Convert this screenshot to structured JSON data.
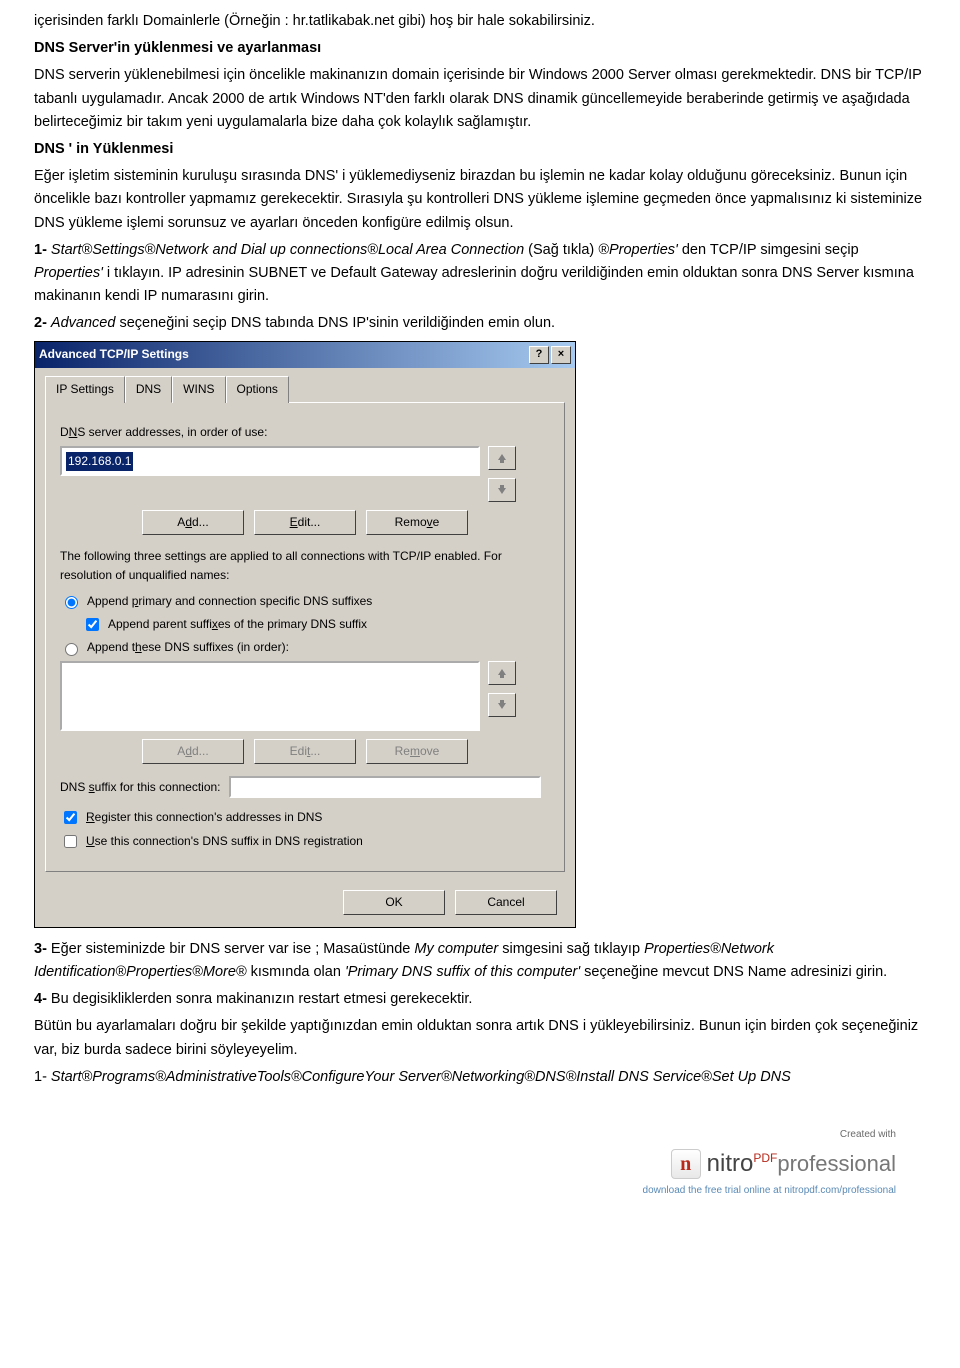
{
  "body": {
    "intro_line": "içerisinden farklı Domainlerle (Örneğin : hr.tatlikabak.net gibi) hoş bir hale sokabilirsiniz.",
    "heading1": "DNS Server'in yüklenmesi ve ayarlanması",
    "para1": "DNS serverin yüklenebilmesi için öncelikle makinanızın domain içerisinde bir Windows 2000 Server olması gerekmektedir. DNS bir TCP/IP tabanlı uygulamadır. Ancak 2000 de artık Windows NT'den farklı olarak DNS dinamik güncellemeyide beraberinde getirmiş ve aşağıdada belirteceğimiz bir takım yeni uygulamalarla bize daha çok kolaylık sağlamıştır.",
    "heading2": "DNS ' in Yüklenmesi",
    "para2a": "Eğer işletim sisteminin kuruluşu sırasında DNS' i yüklemediyseniz birazdan bu işlemin ne kadar kolay olduğunu göreceksiniz. Bunun için öncelikle bazı kontroller yapmamız gerekecektir. Sırasıyla şu kontrolleri DNS yükleme işlemine geçmeden önce yapmalısınız ki sisteminize DNS yükleme işlemi sorunsuz ve ayarları önceden konfigüre edilmiş olsun.",
    "step1_prefix": "1- ",
    "step1_italic": "Start®Settings®Network and Dial up connections®Local Area Connection",
    "step1_mid": "(Sağ tıkla) ",
    "step1_italic2": "®Properties' ",
    "step1_tail": "den TCP/IP simgesini seçip ",
    "step1_italic3": "Properties'",
    "step1_tail2": "i tıklayın. IP adresinin SUBNET ve Default Gateway adreslerinin doğru verildiğinden emin olduktan sonra DNS Server kısmına makinanın kendi IP numarasını girin.",
    "step2_prefix": "2- ",
    "step2_italic": "Advanced ",
    "step2_tail": "seçeneğini seçip DNS tabında DNS IP'sinin verildiğinden emin olun.",
    "step3_prefix": "3- ",
    "step3_a": "Eğer sisteminizde bir DNS server var ise ; Masaüstünde ",
    "step3_italic1": "My computer",
    "step3_b": " simgesini sağ tıklayıp ",
    "step3_italic2": "Properties®Network Identification®Properties®More®",
    "step3_c": " kısmında olan ",
    "step3_italic3": "'Primary DNS suffix of this computer'",
    "step3_d": " seçeneğine mevcut DNS Name adresinizi girin.",
    "step4_prefix": "4- ",
    "step4": "Bu degisikliklerden sonra makinanızın restart etmesi gerekecektir.",
    "closing1": "Bütün bu ayarlamaları doğru bir şekilde yaptığınızdan emin olduktan sonra artık DNS i yükleyebilirsiniz. Bunun için birden çok seçeneğiniz var, biz burda sadece birini söyleyeyelim.",
    "closing2_prefix": "1- ",
    "closing2_italic": "Start®Programs®AdministrativeTools®ConfigureYour Server®Networking®DNS®Install DNS Service®Set Up DNS"
  },
  "dialog": {
    "title": "Advanced TCP/IP Settings",
    "help": "?",
    "close": "×",
    "tabs": {
      "ip": "IP Settings",
      "dns": "DNS",
      "wins": "WINS",
      "options": "Options"
    },
    "label_servers_pre": "D",
    "label_servers_ul": "N",
    "label_servers_post": "S server addresses, in order of use:",
    "server_ip": "192.168.0.1",
    "btn_add_pre": "A",
    "btn_add_ul": "d",
    "btn_add_post": "d...",
    "btn_edit_pre": "",
    "btn_edit_ul": "E",
    "btn_edit_post": "dit...",
    "btn_remove_pre": "Remo",
    "btn_remove_ul": "v",
    "btn_remove_post": "e",
    "info_text": "The following three settings are applied to all connections with TCP/IP enabled. For resolution of unqualified names:",
    "radio1_pre": "Append ",
    "radio1_ul": "p",
    "radio1_post": "rimary and connection specific DNS suffixes",
    "check1_pre": "Append parent suffi",
    "check1_ul": "x",
    "check1_post": "es of the primary DNS suffix",
    "radio2_pre": "Append t",
    "radio2_ul": "h",
    "radio2_post": "ese DNS suffixes (in order):",
    "btn_add2_pre": "A",
    "btn_add2_ul": "d",
    "btn_add2_post": "d...",
    "btn_edit2_pre": "Edi",
    "btn_edit2_ul": "t",
    "btn_edit2_post": "...",
    "btn_remove2_pre": "Re",
    "btn_remove2_ul": "m",
    "btn_remove2_post": "ove",
    "suffix_label_pre": "DNS ",
    "suffix_label_ul": "s",
    "suffix_label_post": "uffix for this connection:",
    "check2_pre": "",
    "check2_ul": "R",
    "check2_post": "egister this connection's addresses in DNS",
    "check3_pre": "",
    "check3_ul": "U",
    "check3_post": "se this connection's DNS suffix in DNS registration",
    "ok": "OK",
    "cancel": "Cancel"
  },
  "footer": {
    "created": "Created with",
    "brand_main": "nitro",
    "brand_pdf": "PDF",
    "brand_pro": "professional",
    "download": "download the free trial online at nitropdf.com/professional"
  }
}
